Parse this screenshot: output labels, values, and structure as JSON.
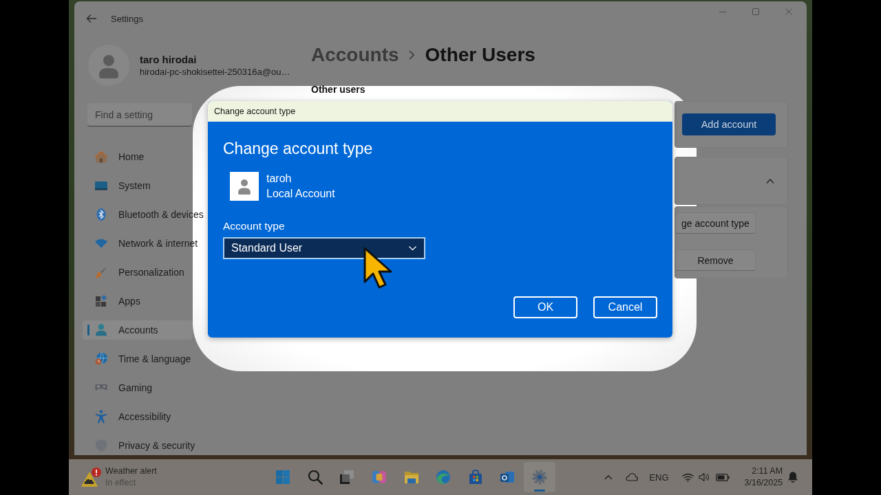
{
  "window": {
    "title": "Settings"
  },
  "profile": {
    "name": "taro hirodai",
    "email": "hirodai-pc-shokisettei-250316a@ou…"
  },
  "search": {
    "placeholder": "Find a setting"
  },
  "sidebar": {
    "items": [
      {
        "label": "Home",
        "selected": false
      },
      {
        "label": "System",
        "selected": false
      },
      {
        "label": "Bluetooth & devices",
        "selected": false
      },
      {
        "label": "Network & internet",
        "selected": false
      },
      {
        "label": "Personalization",
        "selected": false
      },
      {
        "label": "Apps",
        "selected": false
      },
      {
        "label": "Accounts",
        "selected": true
      },
      {
        "label": "Time & language",
        "selected": false
      },
      {
        "label": "Gaming",
        "selected": false
      },
      {
        "label": "Accessibility",
        "selected": false
      },
      {
        "label": "Privacy & security",
        "selected": false
      }
    ]
  },
  "breadcrumb": {
    "parent": "Accounts",
    "current": "Other Users"
  },
  "other_users": {
    "heading": "Other users",
    "add_button": "Add account",
    "user_card": {
      "expanded": true,
      "actions": [
        "ge account type",
        "Remove"
      ]
    }
  },
  "dialog": {
    "title": "Change account type",
    "heading": "Change account type",
    "user": {
      "name": "taroh",
      "account": "Local Account"
    },
    "field_label": "Account type",
    "dropdown": {
      "value": "Standard User"
    },
    "buttons": [
      "OK",
      "Cancel"
    ]
  },
  "taskbar": {
    "weather": {
      "title": "Weather alert",
      "status": "In effect"
    },
    "apps": [
      {
        "selected": false
      },
      {
        "selected": false
      },
      {
        "selected": false
      },
      {
        "selected": false
      },
      {
        "selected": false
      },
      {
        "selected": false
      },
      {
        "selected": false
      },
      {
        "selected": false
      },
      {
        "selected": true
      }
    ],
    "tray": {
      "language": "ENG",
      "time": "2:11 AM",
      "date": "3/16/2025"
    }
  }
}
